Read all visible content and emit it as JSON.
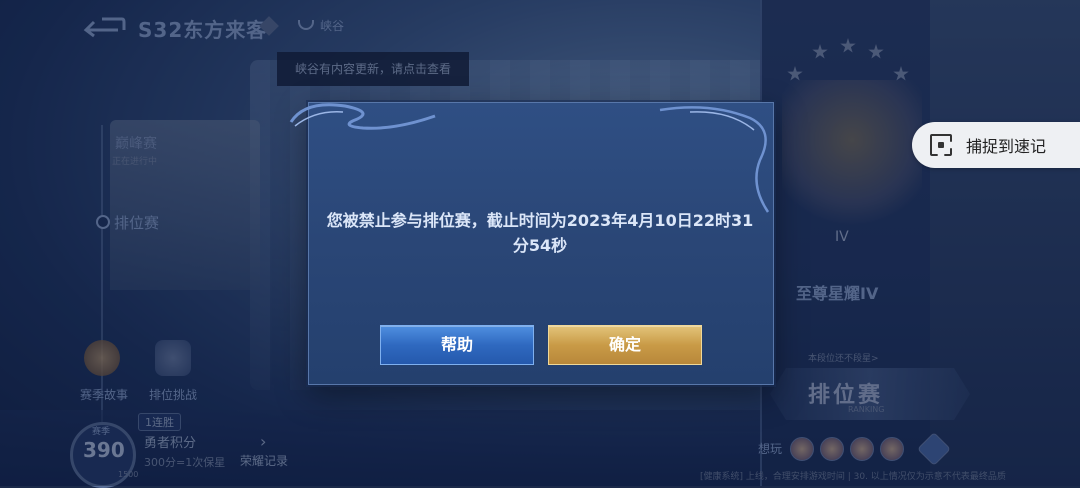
{
  "top_bar": {
    "season_title": "S32东方来客",
    "canyon_label": "峡谷",
    "update_tooltip": "峡谷有内容更新，请点击查看"
  },
  "left_menu": {
    "peak_label": "巅峰赛",
    "peak_status": "正在进行中",
    "ranked_label": "排位赛"
  },
  "bottom_left": {
    "season_story": "赛季故事",
    "rank_challenge": "排位挑战",
    "brave_season_tag": "赛季",
    "brave_points": "390",
    "brave_max": "1500",
    "streak_badge": "1连胜",
    "brave_title": "勇者积分",
    "brave_desc": "300分=1次保星",
    "honor_label": "荣耀记录"
  },
  "right_panel": {
    "rank_roman": "IV",
    "rank_name": "至尊星耀IV",
    "rank_sub": "本段位还不段星>",
    "ranked_match": "排位赛",
    "ranked_match_en": "RANKING",
    "want_play": "想玩",
    "footer_note": "[健康系统] 上线，合理安排游戏时间 | 30. 以上情况仅为示意不代表最终品质"
  },
  "capture_chip": {
    "label": "捕捉到速记",
    "icon": "capture-frame-icon"
  },
  "dialog": {
    "message": "您被禁止参与排位赛，截止时间为2023年4月10日22时31分54秒",
    "help_button": "帮助",
    "confirm_button": "确定"
  }
}
